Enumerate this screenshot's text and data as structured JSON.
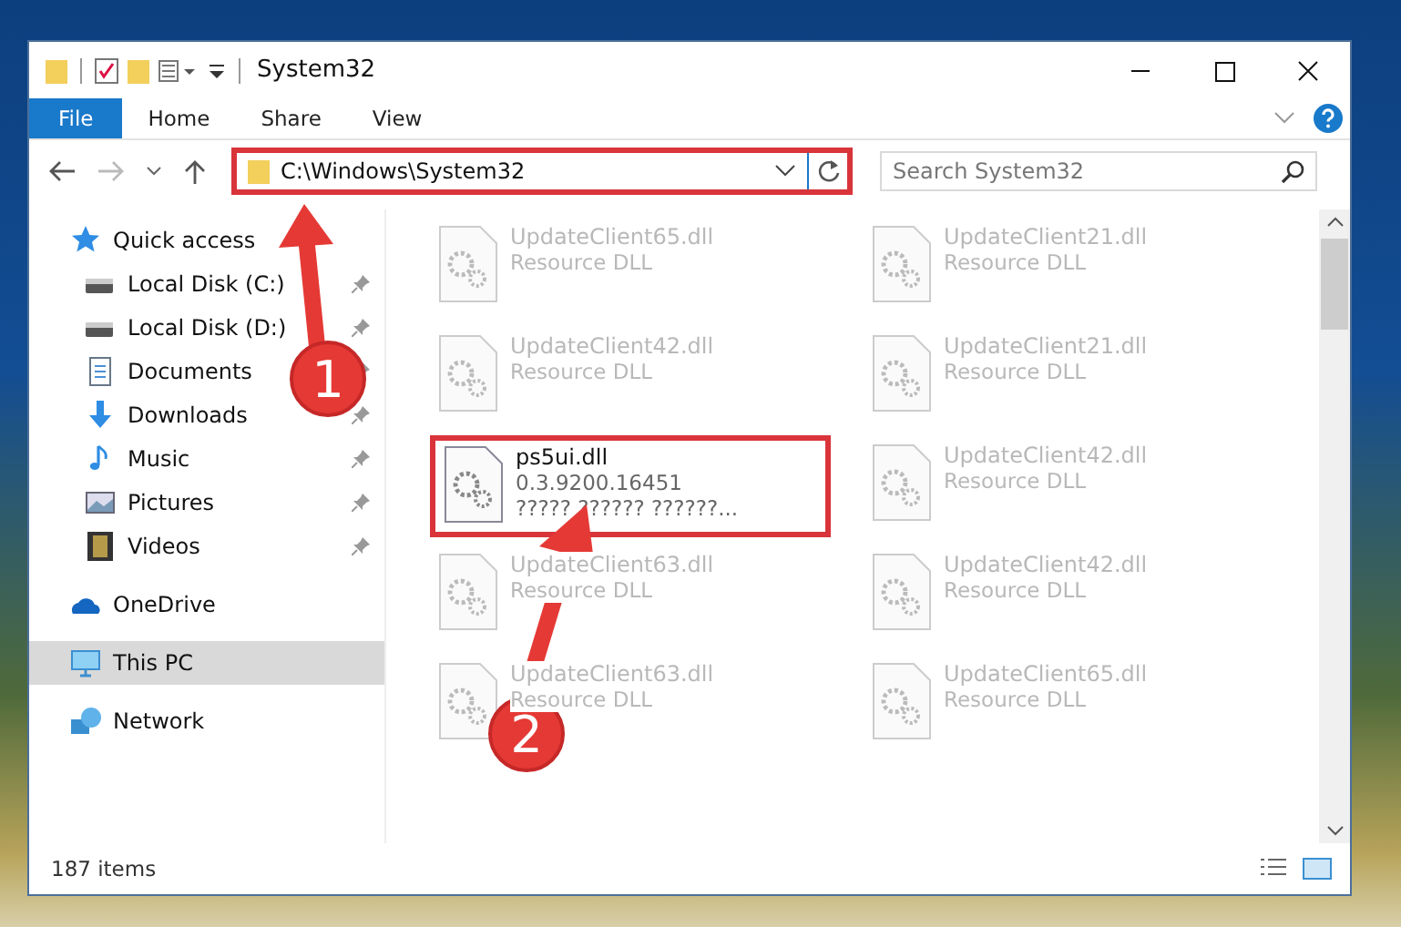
{
  "window": {
    "title": "System32"
  },
  "ribbon_tabs": [
    {
      "label": "File",
      "kind": "file"
    },
    {
      "label": "Home",
      "kind": "tab"
    },
    {
      "label": "Share",
      "kind": "tab"
    },
    {
      "label": "View",
      "kind": "tab"
    }
  ],
  "address_bar": {
    "path": "C:\\Windows\\System32",
    "annotated": true
  },
  "search": {
    "placeholder": "Search System32"
  },
  "sidebar": {
    "items": [
      {
        "label": "Quick access",
        "kind": "star",
        "selected": false,
        "children": [
          {
            "label": "Local Disk (C:)",
            "kind": "drive",
            "selected": false,
            "pinned": true
          },
          {
            "label": "Local Disk (D:)",
            "kind": "drive",
            "selected": false,
            "pinned": true
          },
          {
            "label": "Documents",
            "kind": "document",
            "selected": false,
            "pinned": true
          },
          {
            "label": "Downloads",
            "kind": "download",
            "selected": false,
            "pinned": true
          },
          {
            "label": "Music",
            "kind": "music",
            "selected": false,
            "pinned": true
          },
          {
            "label": "Pictures",
            "kind": "picture",
            "selected": false,
            "pinned": true
          },
          {
            "label": "Videos",
            "kind": "video",
            "selected": false,
            "pinned": true
          }
        ]
      },
      {
        "label": "OneDrive",
        "kind": "cloud",
        "selected": false
      },
      {
        "label": "This PC",
        "kind": "computer",
        "selected": true
      },
      {
        "label": "Network",
        "kind": "network",
        "selected": false
      }
    ]
  },
  "files": [
    {
      "name": "UpdateClient65.dll",
      "details": [
        "Resource DLL"
      ],
      "blurred": true,
      "annotated": false
    },
    {
      "name": "UpdateClient21.dll",
      "details": [
        "Resource DLL"
      ],
      "blurred": true,
      "annotated": false
    },
    {
      "name": "UpdateClient42.dll",
      "details": [
        "Resource DLL"
      ],
      "blurred": true,
      "annotated": false
    },
    {
      "name": "UpdateClient21.dll",
      "details": [
        "Resource DLL"
      ],
      "blurred": true,
      "annotated": false
    },
    {
      "name": "ps5ui.dll",
      "details": [
        "0.3.9200.16451",
        "????? ?????? ??????..."
      ],
      "blurred": false,
      "annotated": true
    },
    {
      "name": "UpdateClient42.dll",
      "details": [
        "Resource DLL"
      ],
      "blurred": true,
      "annotated": false
    },
    {
      "name": "UpdateClient63.dll",
      "details": [
        "Resource DLL"
      ],
      "blurred": true,
      "annotated": false
    },
    {
      "name": "UpdateClient42.dll",
      "details": [
        "Resource DLL"
      ],
      "blurred": true,
      "annotated": false
    },
    {
      "name": "UpdateClient63.dll",
      "details": [
        "Resource DLL"
      ],
      "blurred": true,
      "annotated": false
    },
    {
      "name": "UpdateClient65.dll",
      "details": [
        "Resource DLL"
      ],
      "blurred": true,
      "annotated": false
    }
  ],
  "status_bar": {
    "item_count": "187 items"
  },
  "annotations": [
    {
      "label": "1"
    },
    {
      "label": "2"
    }
  ]
}
